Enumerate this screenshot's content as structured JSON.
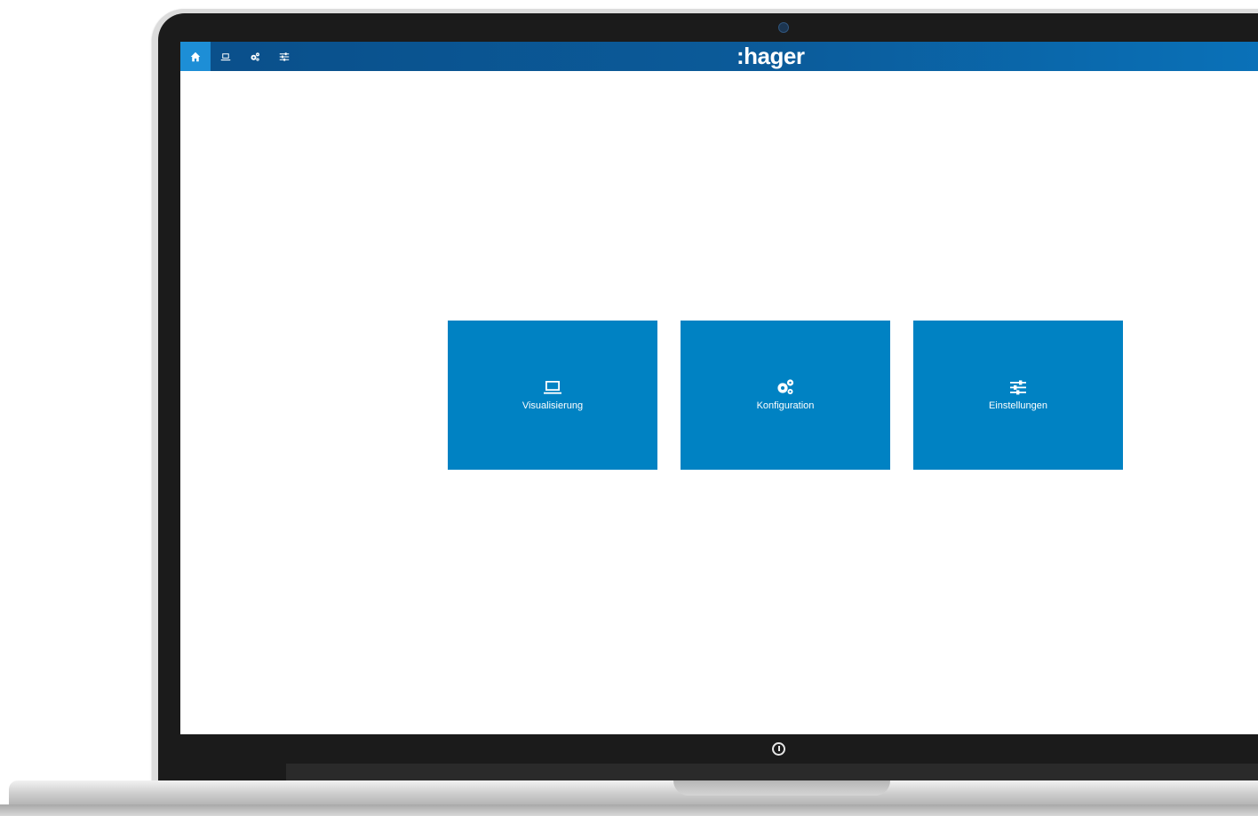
{
  "header": {
    "logo_text": ":hager",
    "nav": [
      {
        "icon": "home-icon",
        "active": true
      },
      {
        "icon": "laptop-icon",
        "active": false
      },
      {
        "icon": "gears-icon",
        "active": false
      },
      {
        "icon": "sliders-icon",
        "active": false
      }
    ]
  },
  "tiles": [
    {
      "label": "Visualisierung",
      "icon": "laptop-icon"
    },
    {
      "label": "Konfiguration",
      "icon": "gears-icon"
    },
    {
      "label": "Einstellungen",
      "icon": "sliders-icon"
    }
  ],
  "colors": {
    "header_bar": "#0b5b9a",
    "active_nav": "#1d8ed6",
    "tile": "#0082c3",
    "text_on_blue": "#ffffff"
  }
}
